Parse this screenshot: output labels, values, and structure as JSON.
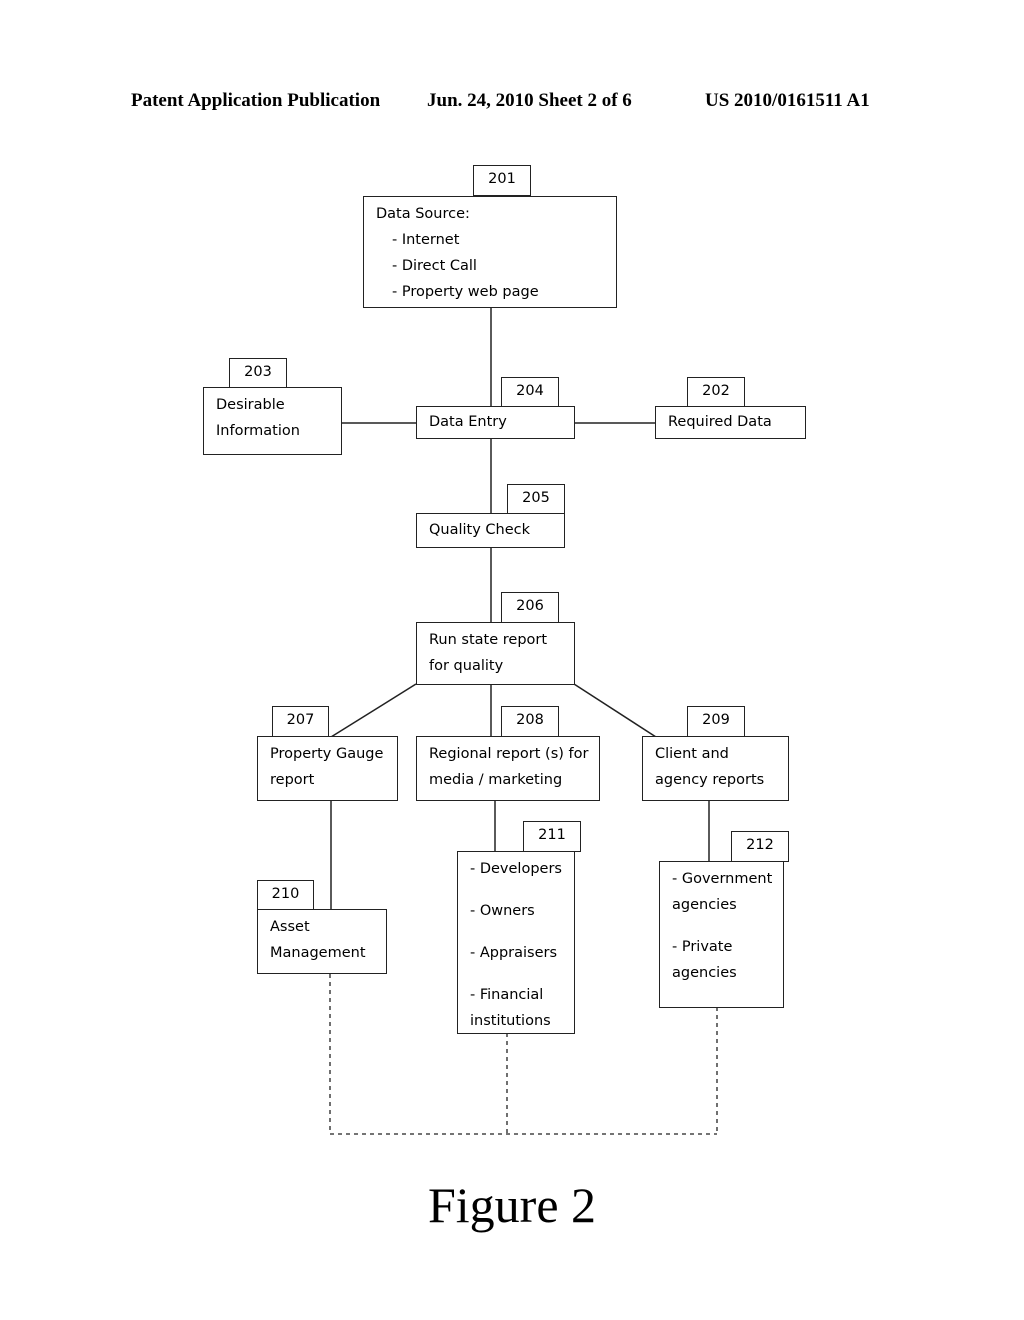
{
  "header": {
    "publication": "Patent Application Publication",
    "date_sheet": "Jun. 24, 2010  Sheet 2 of 6",
    "patent_number": "US 2010/0161511 A1"
  },
  "nodes": {
    "n201": {
      "ref": "201",
      "title": "Data Source:",
      "items": [
        "- Internet",
        "- Direct Call",
        "- Property web page"
      ]
    },
    "n202": {
      "ref": "202",
      "lines": [
        "Required Data"
      ]
    },
    "n203": {
      "ref": "203",
      "lines": [
        "Desirable",
        "Information"
      ]
    },
    "n204": {
      "ref": "204",
      "lines": [
        "Data Entry"
      ]
    },
    "n205": {
      "ref": "205",
      "lines": [
        "Quality Check"
      ]
    },
    "n206": {
      "ref": "206",
      "lines": [
        "Run state report",
        "for quality"
      ]
    },
    "n207": {
      "ref": "207",
      "lines": [
        "Property Gauge",
        "report"
      ]
    },
    "n208": {
      "ref": "208",
      "lines": [
        "Regional report (s) for",
        "media / marketing"
      ]
    },
    "n209": {
      "ref": "209",
      "lines": [
        "Client and",
        "agency reports"
      ]
    },
    "n210": {
      "ref": "210",
      "lines": [
        "Asset",
        "Management"
      ]
    },
    "n211": {
      "ref": "211",
      "lines": [
        "- Developers",
        "-  Owners",
        "-  Appraisers",
        "-  Financial",
        "institutions"
      ]
    },
    "n212": {
      "ref": "212",
      "lines": [
        "- Government",
        "agencies",
        "-  Private",
        "agencies"
      ]
    }
  },
  "edges": [
    {
      "from": "201",
      "to": "204",
      "style": "solid"
    },
    {
      "from": "203",
      "to": "204",
      "style": "solid"
    },
    {
      "from": "204",
      "to": "202",
      "style": "solid"
    },
    {
      "from": "204",
      "to": "205",
      "style": "solid"
    },
    {
      "from": "205",
      "to": "206",
      "style": "solid"
    },
    {
      "from": "206",
      "to": "207",
      "style": "solid"
    },
    {
      "from": "206",
      "to": "208",
      "style": "solid"
    },
    {
      "from": "206",
      "to": "209",
      "style": "solid"
    },
    {
      "from": "207",
      "to": "210",
      "style": "solid"
    },
    {
      "from": "208",
      "to": "211",
      "style": "solid"
    },
    {
      "from": "209",
      "to": "212",
      "style": "solid"
    },
    {
      "from": "210",
      "to": "211",
      "style": "dashed"
    },
    {
      "from": "211",
      "to": "212",
      "style": "dashed"
    }
  ],
  "figure_label": "Figure 2"
}
